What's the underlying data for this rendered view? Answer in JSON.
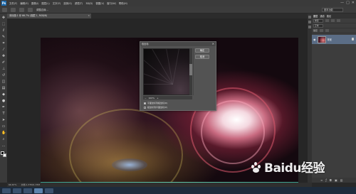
{
  "app": {
    "logo": "Ps",
    "menu": [
      "文件(F)",
      "编辑(E)",
      "图像(I)",
      "图层(L)",
      "文字(Y)",
      "选择(S)",
      "滤镜(T)",
      "3D(D)",
      "视图(V)",
      "窗口(W)",
      "帮助(H)"
    ],
    "window_buttons": [
      "—",
      "□",
      "✕"
    ]
  },
  "options_bar": {
    "mode_label": "调整边缘...",
    "workspace": "基本功能"
  },
  "document_tab": {
    "title": "未标题-1 @ 66.7% (图层 1, RGB/8)",
    "close": "×"
  },
  "dialog": {
    "title": "极坐标",
    "close": "✕",
    "ok_label": "确定",
    "cancel_label": "取消",
    "zoom_value": "100%",
    "zoom_minus": "−",
    "zoom_plus": "+",
    "option1": "平面坐标到极坐标(R)",
    "option2": "极坐标到平面坐标(P)",
    "option1_selected": true
  },
  "panel": {
    "tabs": [
      "图层",
      "通道",
      "路径"
    ],
    "kind_label": "类型",
    "blend_mode": "正常",
    "lock_label": "锁定",
    "layer_name": "背景"
  },
  "status": {
    "zoom": "66.67%",
    "doc_size": "文档:1.37M/1.37M"
  },
  "watermark": {
    "text": "Baidu经验"
  },
  "colors": {
    "accent": "#5b6d86",
    "ps_blue": "#1b6bb0"
  }
}
